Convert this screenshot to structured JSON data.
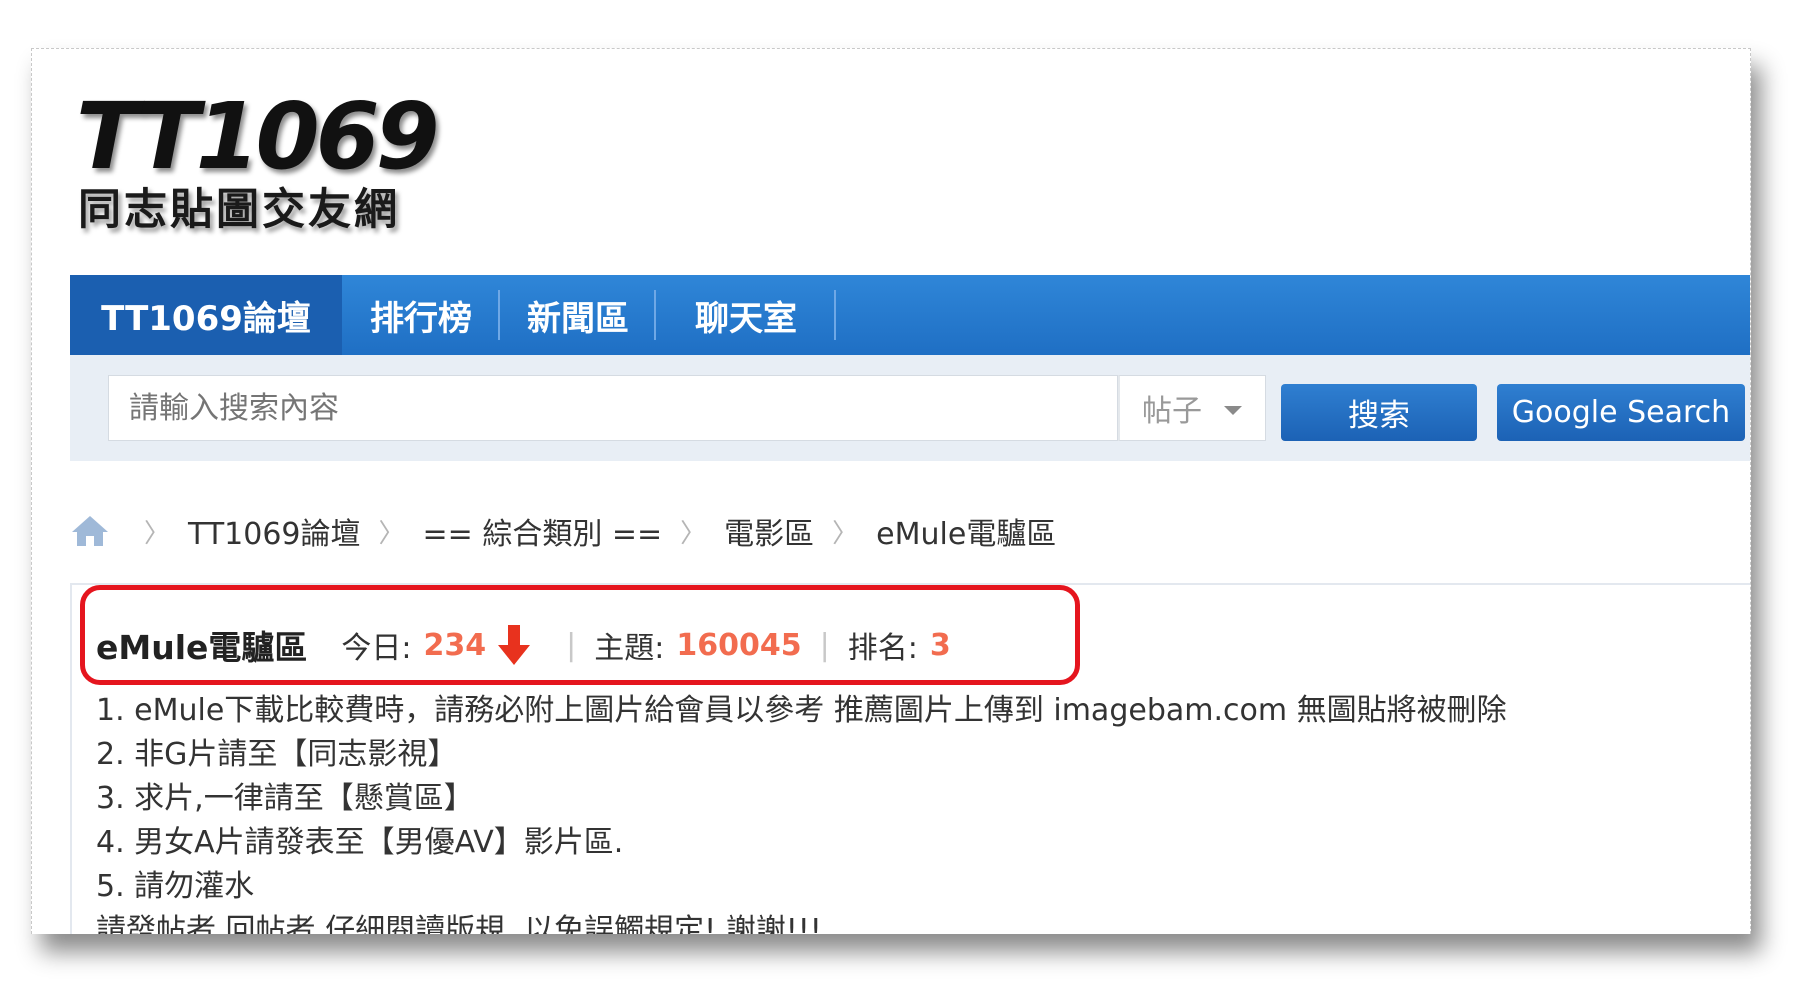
{
  "logo": {
    "main": "TT1069",
    "sub": "同志貼圖交友網"
  },
  "nav": {
    "items": [
      {
        "label": "TT1069論壇"
      },
      {
        "label": "排行榜"
      },
      {
        "label": "新聞區"
      },
      {
        "label": "聊天室"
      }
    ]
  },
  "search": {
    "placeholder": "請輸入搜索內容",
    "type_selected": "帖子",
    "search_button": "搜索",
    "google_button": "Google Search"
  },
  "breadcrumb": {
    "items": [
      "TT1069論壇",
      "== 綜合類別 ==",
      "電影區",
      "eMule電驢區"
    ],
    "separator": "〉"
  },
  "forum": {
    "name": "eMule電驢區",
    "today_label": "今日:",
    "today_value": "234",
    "topics_label": "主題:",
    "topics_value": "160045",
    "rank_label": "排名:",
    "rank_value": "3",
    "stat_separator": "|"
  },
  "rules": [
    "1. eMule下載比較費時，請務必附上圖片給會員以參考 推薦圖片上傳到 imagebam.com 無圖貼將被刪除",
    "2. 非G片請至【同志影視】",
    "3. 求片,一律請至【懸賞區】",
    "4. 男女A片請發表至【男優AV】影片區.",
    "5. 請勿灌水",
    "請發帖者,回帖者,仔細閱讀版規. 以免誤觸規定! 謝謝!!!"
  ],
  "colors": {
    "nav_bg": "#2f86d8",
    "nav_active": "#1b5fb0",
    "stat_value": "#f26c4f",
    "highlight_border": "#e5151e",
    "arrow": "#e8321e"
  }
}
